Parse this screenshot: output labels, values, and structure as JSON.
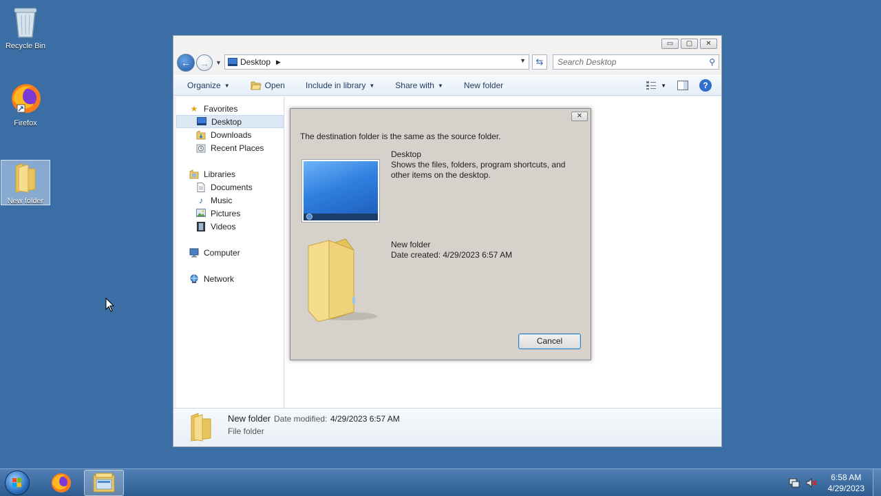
{
  "desktop": {
    "icons": [
      {
        "label": "Recycle Bin"
      },
      {
        "label": "Firefox"
      },
      {
        "label": "New folder"
      }
    ]
  },
  "window": {
    "caption": {
      "minimize": "▭",
      "maximize": "▢",
      "close": "✕"
    },
    "address": {
      "location": "Desktop"
    },
    "search": {
      "placeholder": "Search Desktop"
    },
    "toolbar": {
      "organize": "Organize",
      "open": "Open",
      "include_in_library": "Include in library",
      "share_with": "Share with",
      "new_folder": "New folder"
    },
    "navpane": {
      "favorites": "Favorites",
      "desktop": "Desktop",
      "downloads": "Downloads",
      "recent_places": "Recent Places",
      "libraries": "Libraries",
      "documents": "Documents",
      "music": "Music",
      "pictures": "Pictures",
      "videos": "Videos",
      "computer": "Computer",
      "network": "Network"
    },
    "details": {
      "name": "New folder",
      "date_key": "Date modified:",
      "date_val": "4/29/2023 6:57 AM",
      "type": "File folder"
    }
  },
  "dialog": {
    "message": "The destination folder is the same as the source folder.",
    "source": {
      "title": "Desktop",
      "line1": "Shows the files, folders, program shortcuts, and",
      "line2": "other items on the desktop."
    },
    "destination": {
      "title": "New folder",
      "line1": "Date created: 4/29/2023 6:57 AM"
    },
    "cancel": "Cancel"
  },
  "taskbar": {
    "time": "6:58 AM",
    "date": "4/29/2023"
  },
  "colors": {
    "desktop_bg": "#3a6ea5",
    "dialog_bg": "#d6d2cb",
    "folder": "#f3d77a"
  }
}
